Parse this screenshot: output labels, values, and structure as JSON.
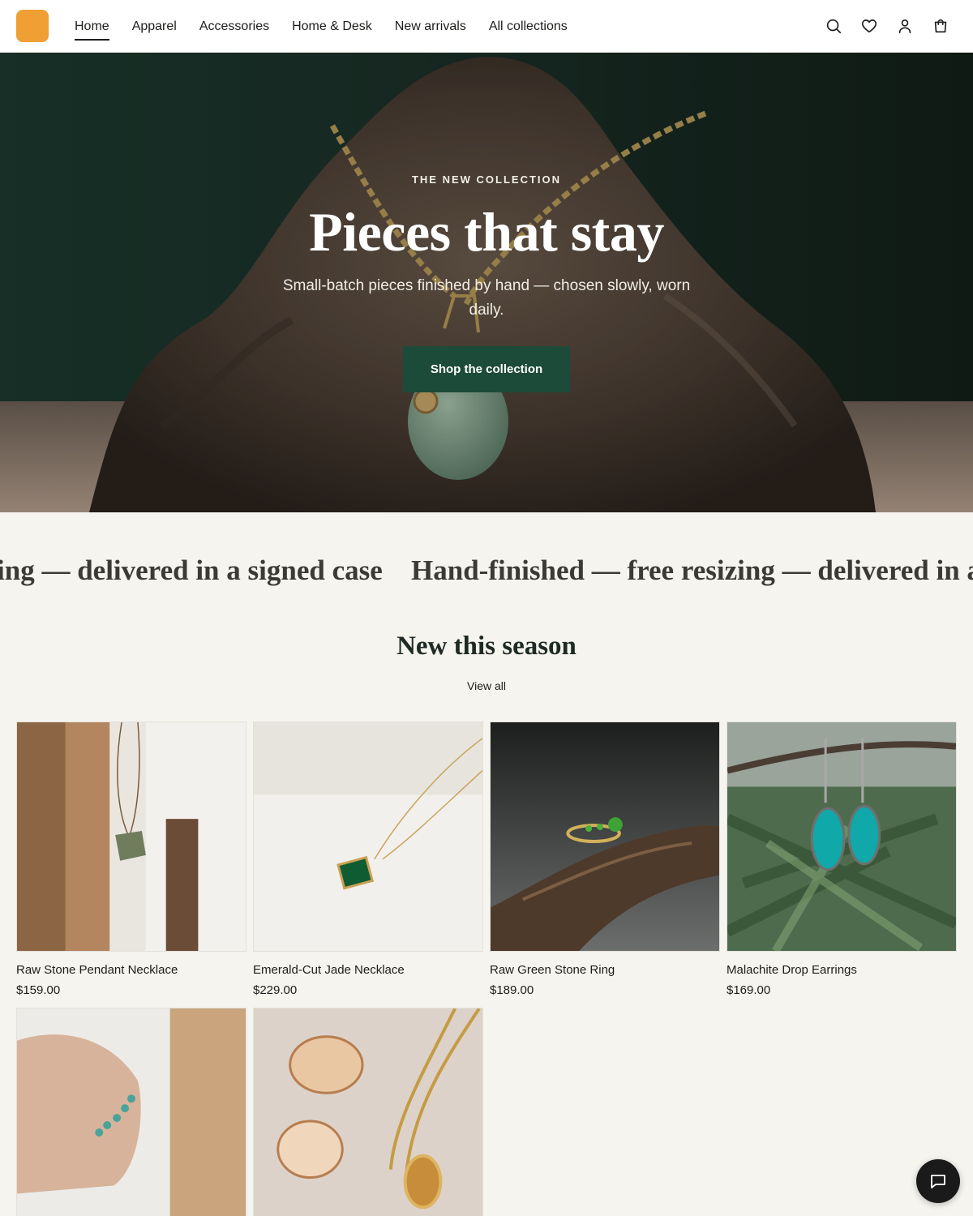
{
  "header": {
    "nav": [
      {
        "label": "Home",
        "active": true
      },
      {
        "label": "Apparel"
      },
      {
        "label": "Accessories"
      },
      {
        "label": "Home & Desk"
      },
      {
        "label": "New arrivals"
      },
      {
        "label": "All collections"
      }
    ],
    "icons": [
      "search-icon",
      "heart-icon",
      "account-icon",
      "cart-icon"
    ],
    "logo_color": "#ef9f34"
  },
  "hero": {
    "eyebrow": "THE NEW COLLECTION",
    "title": "Pieces that stay",
    "subtitle": "Small-batch pieces finished by hand — chosen slowly, worn daily.",
    "cta": "Shop the collection",
    "cta_color": "#1d4b3a"
  },
  "marquee": {
    "text_left": "ing — delivered in a signed case",
    "text_right": "Hand-finished — free resizing — delivered in a s"
  },
  "section": {
    "title": "New this season",
    "view_all": "View all"
  },
  "products": [
    {
      "name": "Raw Stone Pendant Necklace",
      "price": "$159.00"
    },
    {
      "name": "Emerald-Cut Jade Necklace",
      "price": "$229.00"
    },
    {
      "name": "Raw Green Stone Ring",
      "price": "$189.00"
    },
    {
      "name": "Malachite Drop Earrings",
      "price": "$169.00"
    },
    {
      "name": "",
      "price": ""
    },
    {
      "name": "",
      "price": ""
    }
  ],
  "chat": {
    "icon": "chat-icon"
  }
}
